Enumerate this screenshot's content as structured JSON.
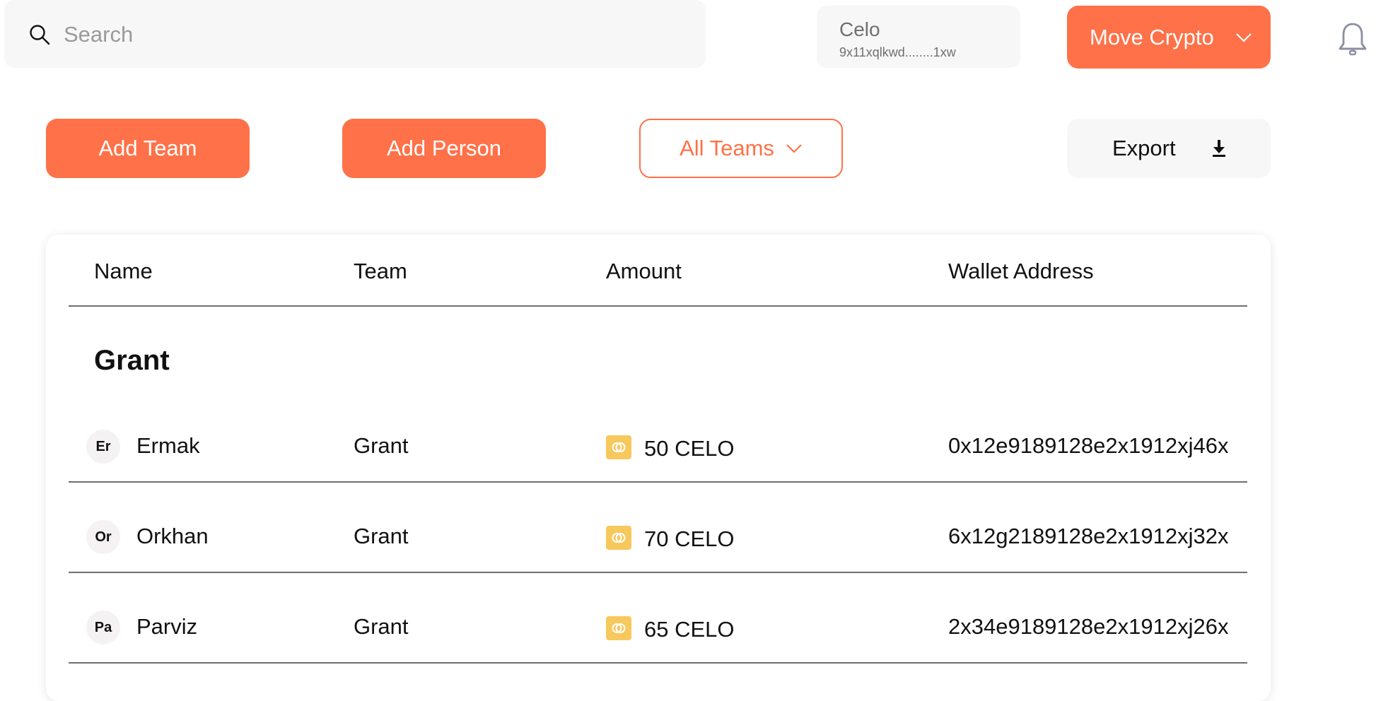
{
  "search": {
    "placeholder": "Search",
    "value": ""
  },
  "wallet": {
    "network": "Celo",
    "address": "9x11xqlkwd........1xw"
  },
  "header": {
    "move_crypto_label": "Move Crypto"
  },
  "toolbar": {
    "add_team_label": "Add Team",
    "add_person_label": "Add Person",
    "team_filter_label": "All Teams",
    "export_label": "Export"
  },
  "table": {
    "columns": [
      "Name",
      "Team",
      "Amount",
      "Wallet Address"
    ],
    "groups": [
      {
        "title": "Grant",
        "rows": [
          {
            "initials": "Er",
            "name": "Ermak",
            "team": "Grant",
            "amount": "50 CELO",
            "address": "0x12e9189128e2x1912xj46x"
          },
          {
            "initials": "Or",
            "name": "Orkhan",
            "team": "Grant",
            "amount": "70 CELO",
            "address": "6x12g2189128e2x1912xj32x"
          },
          {
            "initials": "Pa",
            "name": "Parviz",
            "team": "Grant",
            "amount": "65 CELO",
            "address": "2x34e9189128e2x1912xj26x"
          }
        ]
      }
    ]
  },
  "icons": {
    "search": "search-icon",
    "chevron": "chevron-down-icon",
    "download": "download-icon",
    "bell": "bell-icon",
    "coin": "celo-coin-icon"
  },
  "colors": {
    "accent": "#ff7148",
    "coin": "#f7c85c",
    "surface": "#f8f7f7"
  }
}
